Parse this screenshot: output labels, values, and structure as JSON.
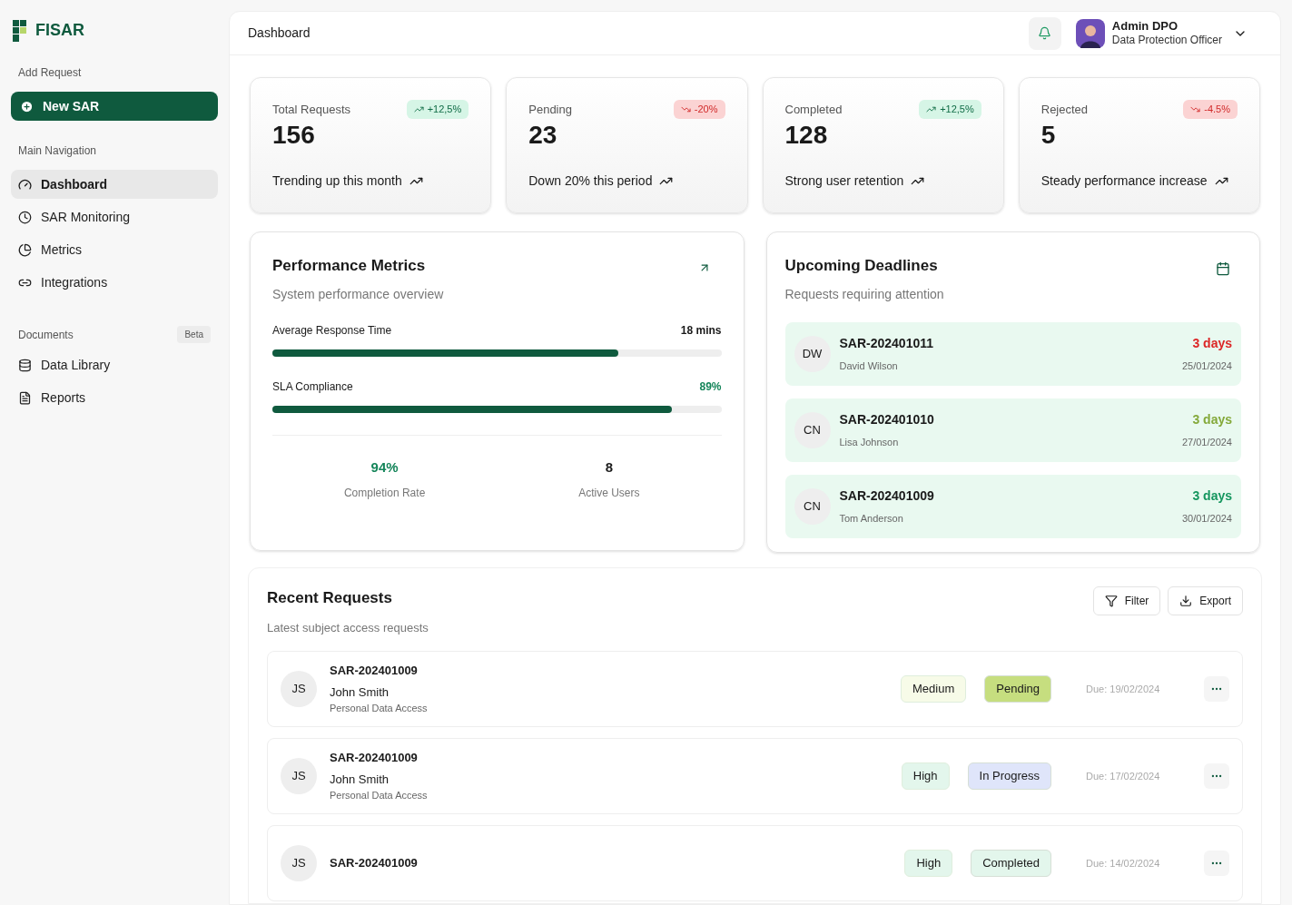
{
  "brand": {
    "name": "FISAR"
  },
  "sidebar": {
    "add_label": "Add Request",
    "new_button": "New SAR",
    "main_label": "Main Navigation",
    "main_items": [
      {
        "label": "Dashboard",
        "selected": true
      },
      {
        "label": "SAR Monitoring",
        "selected": false
      },
      {
        "label": "Metrics",
        "selected": false
      },
      {
        "label": "Integrations",
        "selected": false
      }
    ],
    "docs_label": "Documents",
    "docs_badge": "Beta",
    "doc_items": [
      {
        "label": "Data Library",
        "selected": false
      },
      {
        "label": "Reports",
        "selected": false
      }
    ]
  },
  "header": {
    "title": "Dashboard",
    "user_name": "Admin DPO",
    "user_role": "Data Protection Officer"
  },
  "stats": [
    {
      "label": "Total Requests",
      "value": "156",
      "change": "+12,5%",
      "rising": true,
      "note": "Trending up this month"
    },
    {
      "label": "Pending",
      "value": "23",
      "change": "-20%",
      "rising": false,
      "note": "Down 20% this period"
    },
    {
      "label": "Completed",
      "value": "128",
      "change": "+12,5%",
      "rising": true,
      "note": "Strong user retention"
    },
    {
      "label": "Rejected",
      "value": "5",
      "change": "-4.5%",
      "rising": false,
      "note": "Steady performance increase"
    }
  ],
  "performance": {
    "title": "Performance Metrics",
    "subtitle": "System performance overview",
    "meters": [
      {
        "label": "Average Response Time",
        "reading": "18 mins",
        "level": 0.77,
        "accent": false
      },
      {
        "label": "SLA Compliance",
        "reading": "89%",
        "level": 0.89,
        "accent": true
      }
    ],
    "totals": [
      {
        "value": "94%",
        "label": "Completion Rate",
        "accent": true
      },
      {
        "value": "8",
        "label": "Active Users",
        "accent": false
      }
    ]
  },
  "deadlines": {
    "title": "Upcoming Deadlines",
    "subtitle": "Requests requiring attention",
    "items": [
      {
        "initials": "DW",
        "id": "SAR-202401011",
        "name": "David Wilson",
        "days": "3 days",
        "color": "#dc2626",
        "date": "25/01/2024"
      },
      {
        "initials": "CN",
        "id": "SAR-202401010",
        "name": "Lisa Johnson",
        "days": "3 days",
        "color": "#84a93a",
        "date": "27/01/2024"
      },
      {
        "initials": "CN",
        "id": "SAR-202401009",
        "name": "Tom Anderson",
        "days": "3 days",
        "color": "#15965e",
        "date": "30/01/2024"
      }
    ]
  },
  "recent": {
    "title": "Recent Requests",
    "subtitle": "Latest subject access requests",
    "filter": "Filter",
    "export": "Export",
    "rows": [
      {
        "initials": "JS",
        "id": "SAR-202401009",
        "name": "John Smith",
        "type": "Personal Data Access",
        "priority": {
          "text": "Medium",
          "color": "#f7fbe8"
        },
        "status": {
          "text": "Pending",
          "color": "#c6de7f"
        },
        "due": "Due: 19/02/2024"
      },
      {
        "initials": "JS",
        "id": "SAR-202401009",
        "name": "John Smith",
        "type": "Personal Data Access",
        "priority": {
          "text": "High",
          "color": "#e3f6ec"
        },
        "status": {
          "text": "In Progress",
          "color": "#dfe5fa"
        },
        "due": "Due: 17/02/2024"
      },
      {
        "initials": "JS",
        "id": "SAR-202401009",
        "priority": {
          "text": "High",
          "color": "#e3f6ec"
        },
        "status": {
          "text": "Completed",
          "color": "#e3f6ec"
        },
        "due": "Due: 14/02/2024"
      }
    ]
  }
}
